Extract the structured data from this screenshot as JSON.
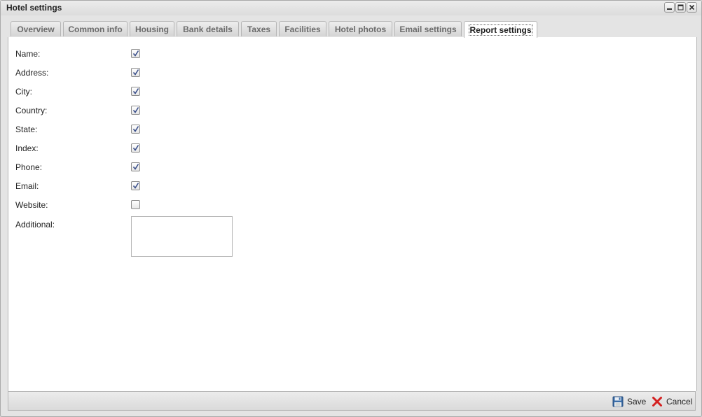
{
  "window": {
    "title": "Hotel settings",
    "tools": [
      "minimize-icon",
      "maximize-icon",
      "close-icon"
    ]
  },
  "tabs": [
    {
      "label": "Overview",
      "active": false
    },
    {
      "label": "Common info",
      "active": false
    },
    {
      "label": "Housing",
      "active": false
    },
    {
      "label": "Bank details",
      "active": false
    },
    {
      "label": "Taxes",
      "active": false
    },
    {
      "label": "Facilities",
      "active": false
    },
    {
      "label": "Hotel photos",
      "active": false
    },
    {
      "label": "Email settings",
      "active": false
    },
    {
      "label": "Report settings",
      "active": true
    }
  ],
  "fields": [
    {
      "label": "Name:",
      "checked": true
    },
    {
      "label": "Address:",
      "checked": true
    },
    {
      "label": "City:",
      "checked": true
    },
    {
      "label": "Country:",
      "checked": true
    },
    {
      "label": "State:",
      "checked": true
    },
    {
      "label": "Index:",
      "checked": true
    },
    {
      "label": "Phone:",
      "checked": true
    },
    {
      "label": "Email:",
      "checked": true
    },
    {
      "label": "Website:",
      "checked": false
    }
  ],
  "additional": {
    "label": "Additional:",
    "value": ""
  },
  "footer": {
    "save_label": "Save",
    "cancel_label": "Cancel",
    "save_icon": "floppy-disk-icon",
    "cancel_icon": "red-x-icon"
  },
  "colors": {
    "check": "#3a4f8a",
    "cancel_icon": "#d42020",
    "save_icon": "#3b6ea8"
  }
}
